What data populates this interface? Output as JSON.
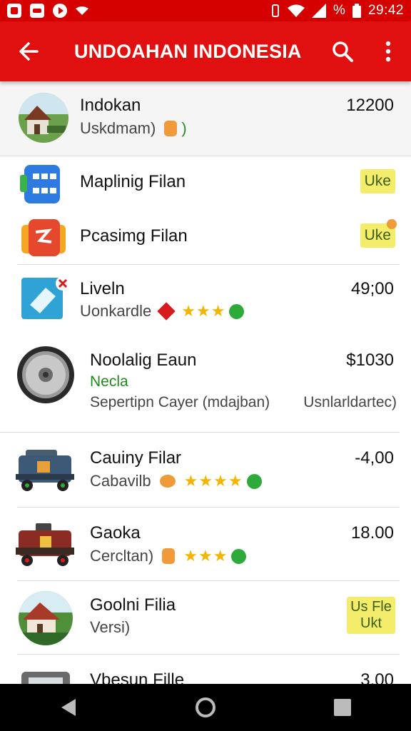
{
  "status_bar": {
    "time": "29:42",
    "percent_icon": "%",
    "icons": [
      "gallery-icon",
      "message-icon",
      "play-icon",
      "wifi-small-icon",
      "vibrate-icon",
      "wifi-icon",
      "signal-icon",
      "battery-icon"
    ]
  },
  "app_bar": {
    "title": "UNDOAHAN INDONESIA",
    "icons": [
      "back-arrow-icon",
      "search-icon",
      "more-vert-icon"
    ]
  },
  "items": [
    {
      "title": "Indokan",
      "subtitle": "Uskdmam)",
      "subtitle_suffix": ")",
      "value": "12200"
    },
    {
      "title": "Maplinig Filan",
      "tag": "Uke"
    },
    {
      "title": "Pcasimg Filan",
      "tag": "Uke"
    },
    {
      "title": "Liveln",
      "subtitle": "Uonkardle",
      "value": "49;00",
      "stars": 3
    },
    {
      "title": "Noolalig Eaun",
      "highlight": "Necla",
      "description": "Sepertipn Cayer (mdajban)",
      "secondary": "Usnlarldartec)",
      "value": "$1030"
    },
    {
      "title": "Cauiny Filar",
      "subtitle": "Cabavilb",
      "value": "-4,00",
      "stars": 4
    },
    {
      "title": "Gaoka",
      "subtitle": "Cercltan)",
      "value": "18.00",
      "stars": 3
    },
    {
      "title": "Goolni Filia",
      "subtitle": "Versi)",
      "tag_line1": "Us Fle",
      "tag_line2": "Ukt"
    },
    {
      "title": "Vbesun Fille",
      "value": "3.00"
    }
  ],
  "colors": {
    "status_bar": "#d50000",
    "app_bar": "#e01010",
    "tag_bg": "#f4ec6b",
    "star": "#f5b400",
    "green_text": "#1e8a1e"
  },
  "nav_bar": {
    "icons": [
      "nav-back-icon",
      "nav-home-icon",
      "nav-recents-icon"
    ]
  }
}
